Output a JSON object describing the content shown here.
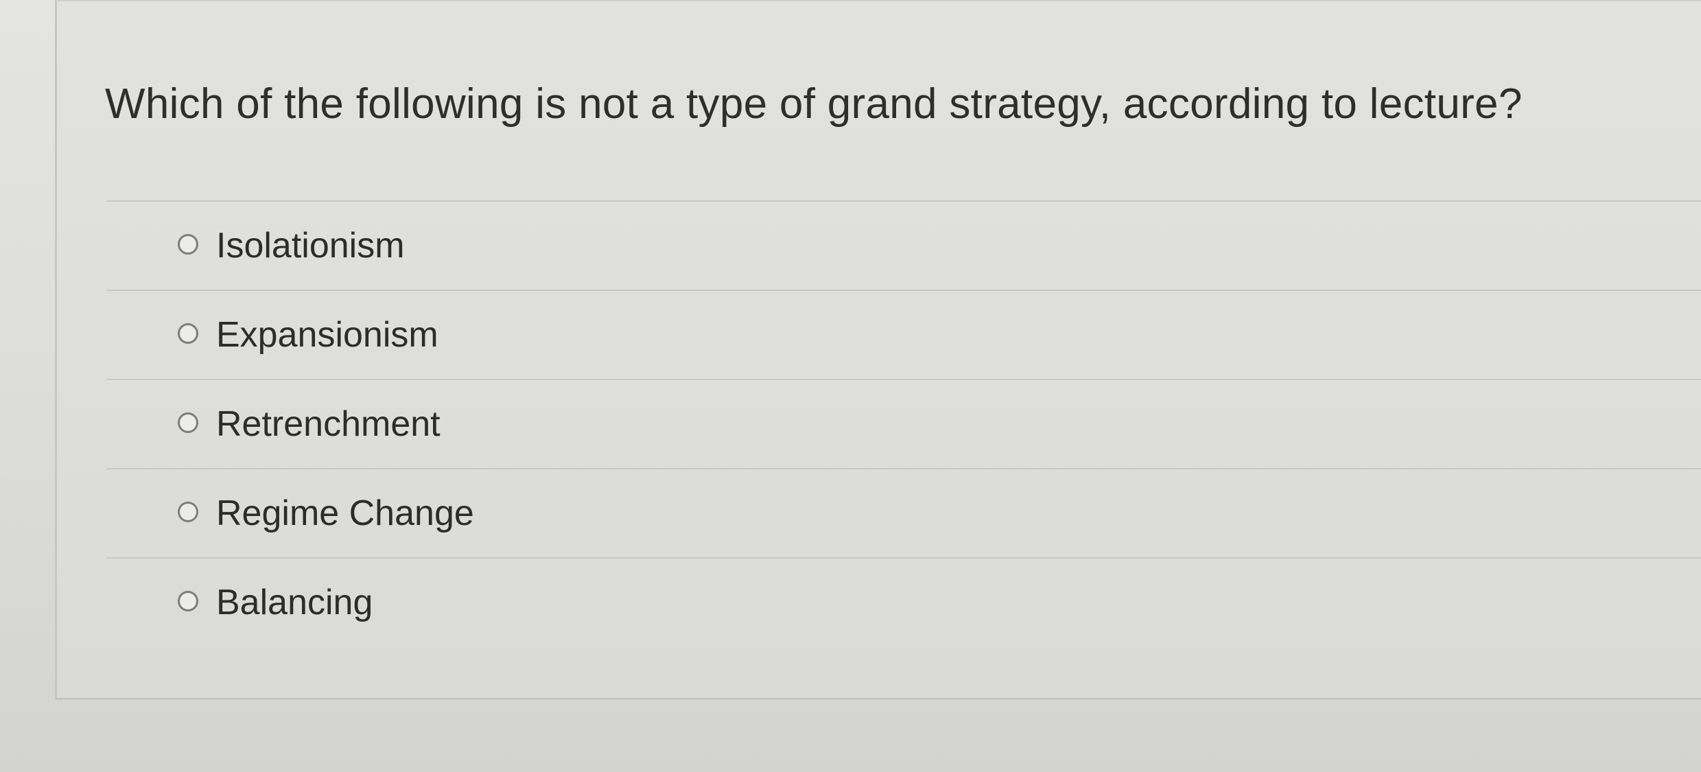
{
  "quiz": {
    "question": "Which of the following is not a type of grand strategy, according to lecture?",
    "answers": [
      {
        "label": "Isolationism",
        "selected": false
      },
      {
        "label": "Expansionism",
        "selected": false
      },
      {
        "label": "Retrenchment",
        "selected": false
      },
      {
        "label": "Regime Change",
        "selected": false
      },
      {
        "label": "Balancing",
        "selected": false
      }
    ]
  }
}
